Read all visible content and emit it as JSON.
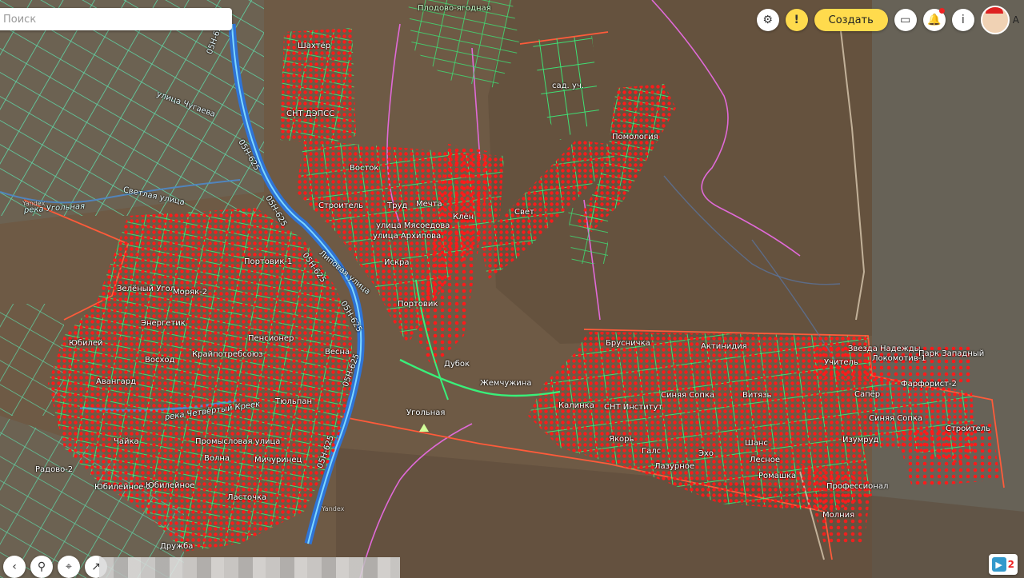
{
  "search": {
    "placeholder": "Поиск"
  },
  "toolbar": {
    "settings_icon": "gear-icon",
    "warning_label": "!",
    "create_label": "Создать",
    "chat_icon": "chat-icon",
    "bell_icon": "bell-icon",
    "info_label": "i",
    "user_initial": "А"
  },
  "bottom": {
    "notification_count": "2"
  },
  "labels": {
    "top_village": "Плодово-ягодная",
    "shakhter": "Шахтёр",
    "snt_deps": "СНТ ДЭПСС",
    "vostok": "Восток",
    "stroitel": "Строитель",
    "trud": "Труд",
    "mechta": "Мечта",
    "klen": "Клён",
    "myasoedova": "улица Мясоедова",
    "arkhipova": "улица Архипова",
    "iskra": "Искра",
    "portovik": "Портовик",
    "portovik1": "Портовик-1",
    "zeleny_ugol": "Зелёный Угол",
    "moryak2": "Моряк-2",
    "energetik": "Энергетик",
    "yubileiny": "Юбилей",
    "voskhod": "Восход",
    "krayportrebsoyuz": "Крайпотребсоюз",
    "pensioner": "Пенсионер",
    "vesna": "Весна",
    "avangard": "Авангард",
    "tyulpan": "Тюльпан",
    "chaika": "Чайка",
    "promyslovaya": "Промысловая улица",
    "volna": "Волна",
    "michurinets": "Мичуринец",
    "radovo2": "Радово-2",
    "yubileynoe2": "Юбилейное-2",
    "yubileynoe": "Юбилейное",
    "lastochka": "Ласточка",
    "druzhba": "Дружба",
    "svetlaya": "Светлая улица",
    "chugaeva": "улица Чугаева",
    "reka_ugolnaya": "река Угольная",
    "reka_chetvertyy": "река Четвёртый Креек",
    "lipovaya": "Липовая улица",
    "ugolnaya": "Угольная",
    "dubok": "Дубок",
    "zhemchuzhina": "Жемчужина",
    "svet": "Свет",
    "pomologiya": "Помология",
    "sad_uch": "сад. уч.",
    "brusnichka": "Брусничка",
    "aktinidiya": "Актинидия",
    "zvezda": "Звезда Надежды",
    "park_zapadny": "Парк Западный",
    "uchitel": "Учитель",
    "lokomotiv1": "Локомотив-1",
    "farforist2": "Фарфорист-2",
    "kalinka": "Калинка",
    "snt_institut": "СНТ Институт",
    "sinyaya_sopka": "Синяя Сопка",
    "sinyaya_sopka2": "Синяя Сопка",
    "vityaz": "Витязь",
    "saper": "Сапёр",
    "stroitel2": "Строитель",
    "yakor": "Якорь",
    "shans": "Шанс",
    "izumrud": "Изумруд",
    "gals": "Галс",
    "ekho": "Эхо",
    "lazurnoe": "Лазурное",
    "lesnoe": "Лесное",
    "romashka": "Ромашка",
    "professionalnaya": "Профессионал",
    "molniya": "Молния",
    "road1": "05Н-625",
    "road2": "05Н-625",
    "road3": "05Н-625",
    "road4": "05Н-625",
    "road5": "05Н-625",
    "road6": "05Н-625",
    "road7": "05Н-625",
    "yandex1": "Yandex",
    "yandex2": "Yandex"
  },
  "colors": {
    "terrain": "#6e5a45",
    "terrain_dark": "#5b4a38",
    "plot_line": "#39f07a",
    "parcel_dot": "#ff1a1a",
    "road": "#4dc3ff",
    "river": "#2f74d6",
    "boundary": "#ff5b3a",
    "magenta_line": "#e06ad8",
    "accent": "#ffdb4d"
  }
}
